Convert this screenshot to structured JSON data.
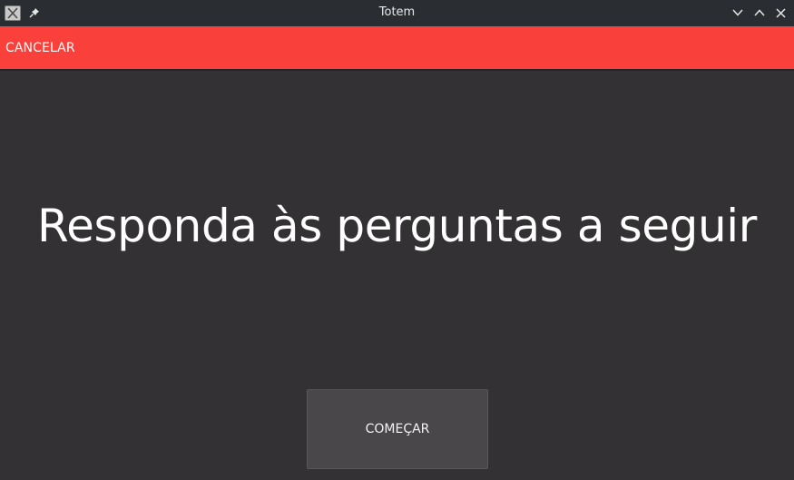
{
  "window": {
    "title": "Totem",
    "icons": {
      "app": "x-app-icon",
      "pin": "pin-icon",
      "minimize": "chevron-down-icon",
      "maximize": "chevron-up-icon",
      "close": "close-icon"
    }
  },
  "actionbar": {
    "cancel_label": "CANCELAR",
    "background_color": "#f9403a"
  },
  "main": {
    "heading": "Responda às perguntas a seguir",
    "start_button_label": "COMEÇAR",
    "background_color": "#333133"
  }
}
